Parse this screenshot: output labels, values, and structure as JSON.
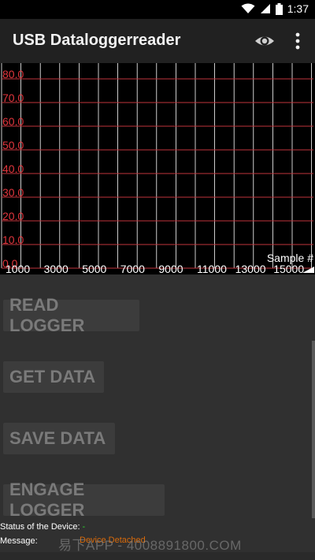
{
  "status_bar": {
    "time": "1:37",
    "icons": [
      "wifi-icon",
      "signal-icon",
      "battery-icon"
    ]
  },
  "app_bar": {
    "title": "USB Dataloggerreader",
    "actions": [
      "eye-icon",
      "overflow-menu-icon"
    ]
  },
  "chart_data": {
    "type": "line",
    "series": [],
    "xlabel": "Sample #",
    "ylabel": "",
    "x_ticks": [
      "1000",
      "3000",
      "5000",
      "7000",
      "9000",
      "11000",
      "13000",
      "15000"
    ],
    "y_ticks": [
      "0.0",
      "10.0",
      "20.0",
      "30.0",
      "40.0",
      "50.0",
      "60.0",
      "70.0",
      "80.0"
    ],
    "grid": true,
    "colors": {
      "background": "#000000",
      "horizontal_grid": "#c0353c",
      "vertical_grid": "#ffffff",
      "y_tick_text": "#e0353c",
      "x_tick_text": "#ffffff"
    }
  },
  "buttons": {
    "read_logger": "READ LOGGER",
    "get_data": "GET DATA",
    "save_data": "SAVE DATA",
    "engage_logger": "ENGAGE LOGGER"
  },
  "info": {
    "status_label": "Status of the Device:",
    "status_value": "-",
    "message_label": "Message:",
    "message_value": "Device Detached"
  },
  "watermark": "易下APP - 4008891800.COM"
}
